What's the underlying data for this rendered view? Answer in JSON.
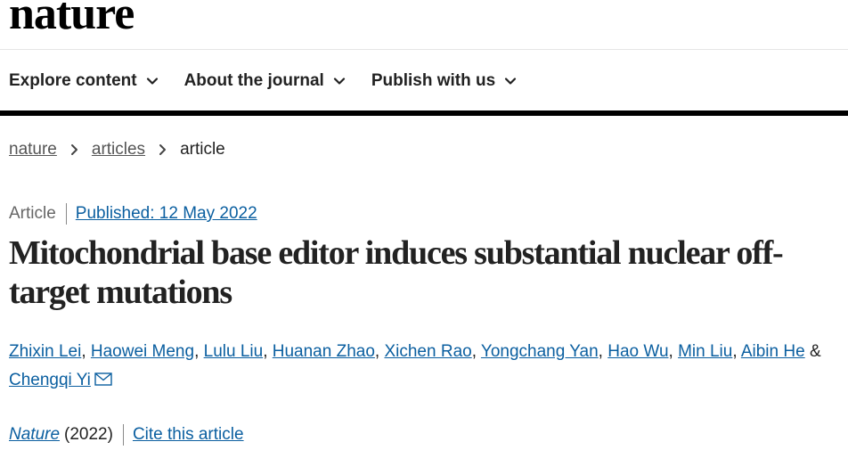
{
  "site": {
    "logo": "nature"
  },
  "nav": {
    "items": [
      {
        "label": "Explore content"
      },
      {
        "label": "About the journal"
      },
      {
        "label": "Publish with us"
      }
    ]
  },
  "breadcrumb": [
    {
      "label": "nature"
    },
    {
      "label": "articles"
    },
    {
      "label": "article"
    }
  ],
  "article": {
    "type": "Article",
    "published": "Published: 12 May 2022",
    "title": "Mitochondrial base editor induces substantial nuclear off-target mutations",
    "authors": [
      "Zhixin Lei",
      "Haowei Meng",
      "Lulu Liu",
      "Huanan Zhao",
      "Xichen Rao",
      "Yongchang Yan",
      "Hao Wu",
      "Min Liu",
      "Aibin He",
      "Chengqi Yi"
    ],
    "author_joiner": "&",
    "journal": "Nature",
    "year": "(2022)",
    "cite_label": "Cite this article"
  },
  "colors": {
    "link": "#0b5fa0",
    "text": "#222222",
    "muted": "#666666"
  },
  "icons": {
    "nav_dropdown": "chevron-down-icon",
    "breadcrumb_sep": "chevron-right-icon",
    "contact": "mail-icon"
  }
}
